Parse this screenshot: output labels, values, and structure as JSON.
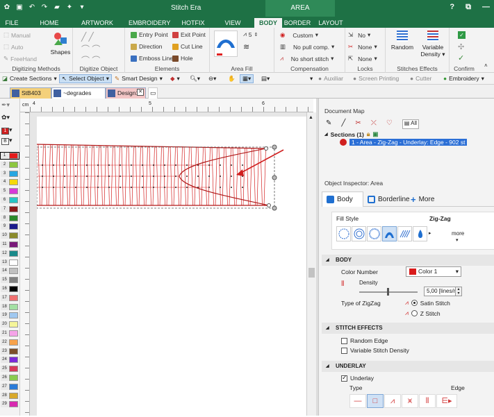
{
  "app": {
    "title": "Stitch Era",
    "context_tab": "AREA"
  },
  "window": {
    "help": "?",
    "restore": "⧉",
    "minimize": "—"
  },
  "tabs": [
    {
      "label": "FILE"
    },
    {
      "label": "HOME"
    },
    {
      "label": "ARTWORK"
    },
    {
      "label": "EMBROIDERY"
    },
    {
      "label": "HOTFIX"
    },
    {
      "label": "VIEW"
    },
    {
      "label": "BODY"
    },
    {
      "label": "BORDER"
    },
    {
      "label": "LAYOUT"
    }
  ],
  "ribbon": {
    "digitizing": {
      "manual": "Manual",
      "auto": "Auto",
      "freehand": "FreeHand",
      "shapes": "Shapes",
      "label": "Digitizing Methods"
    },
    "digitize_object": {
      "label": "Digitize Object"
    },
    "elements": {
      "entry": "Entry Point",
      "exit": "Exit Point",
      "direction": "Direction",
      "cutline": "Cut Line",
      "emboss": "Emboss Line",
      "hole": "Hole",
      "label": "Elements"
    },
    "area_fill": {
      "density_value": "5",
      "label": "Area Fill"
    },
    "compensation": {
      "custom": "Custom",
      "no_pull": "No pull comp.",
      "no_short": "No short stitch",
      "label": "Compensation"
    },
    "locks": {
      "no": "No",
      "none1": "None",
      "none2": "None",
      "label": "Locks"
    },
    "stitches_effects": {
      "random": "Random",
      "variable": "Variable",
      "density": "Density",
      "label": "Stitches Effects"
    },
    "confirm": {
      "label": "Confirm"
    }
  },
  "toolbar": {
    "create_sections": "Create Sections",
    "select_object": "Select Object",
    "smart_design": "Smart Design",
    "auxiliar": "Auxiliar",
    "screen_printing": "Screen Printing",
    "cutter": "Cutter",
    "embroidery": "Embroidery"
  },
  "doc_tabs": [
    {
      "label": "StB403",
      "color": "#f4d07a"
    },
    {
      "label": "~degrades",
      "color": "#ffffff"
    },
    {
      "label": "Design1",
      "color": "#f3c6c6"
    }
  ],
  "ruler": {
    "unit": "cm",
    "ticks": [
      "4",
      "5",
      "6"
    ]
  },
  "palette": [
    {
      "n": "1",
      "color": "#e31b1b"
    },
    {
      "n": "2",
      "color": "#8dc63f"
    },
    {
      "n": "3",
      "color": "#27a6e1"
    },
    {
      "n": "4",
      "color": "#f5d90a"
    },
    {
      "n": "5",
      "color": "#d83ad8"
    },
    {
      "n": "6",
      "color": "#26c6c6"
    },
    {
      "n": "7",
      "color": "#8b1a1a"
    },
    {
      "n": "8",
      "color": "#2b8a2b"
    },
    {
      "n": "9",
      "color": "#1a1a8b"
    },
    {
      "n": "10",
      "color": "#8a8a2b"
    },
    {
      "n": "11",
      "color": "#7a1a7a"
    },
    {
      "n": "12",
      "color": "#1a8a8a"
    },
    {
      "n": "13",
      "color": "#ffffff"
    },
    {
      "n": "14",
      "color": "#c0c0c0"
    },
    {
      "n": "15",
      "color": "#808080"
    },
    {
      "n": "16",
      "color": "#000000"
    },
    {
      "n": "17",
      "color": "#f07070"
    },
    {
      "n": "18",
      "color": "#a3e0a3"
    },
    {
      "n": "19",
      "color": "#a0c8f0"
    },
    {
      "n": "20",
      "color": "#f5f59a"
    },
    {
      "n": "21",
      "color": "#f5a3e8"
    },
    {
      "n": "22",
      "color": "#f7a24a"
    },
    {
      "n": "23",
      "color": "#7b4f2a"
    },
    {
      "n": "24",
      "color": "#7b2ad8"
    },
    {
      "n": "25",
      "color": "#d83a5a"
    },
    {
      "n": "26",
      "color": "#8acb4f"
    },
    {
      "n": "27",
      "color": "#2a7bd8"
    },
    {
      "n": "28",
      "color": "#d8a82a"
    },
    {
      "n": "29",
      "color": "#d82ab0"
    }
  ],
  "document_map": {
    "title": "Document Map",
    "all_label": "All",
    "sections": "Sections (1)",
    "item": "1 - Area - Zig-Zag - Underlay: Edge - 902 st"
  },
  "inspector": {
    "title": "Object Inspector: Area",
    "tabs": {
      "body": "Body",
      "borderline": "Borderline",
      "more": "More"
    },
    "fill_style_label": "Fill Style",
    "fill_style_value": "Zig-Zag",
    "more_label": "more",
    "body_header": "BODY",
    "color_number_label": "Color Number",
    "color_value": "Color 1",
    "color_hex": "#d91a1a",
    "density_label": "Density",
    "density_value": "5,00 [lines/mm]",
    "zigzag_type_label": "Type of ZigZag",
    "satin_label": "Satin Stitch",
    "z_label": "Z Stitch",
    "effects_header": "STITCH EFFECTS",
    "random_edge": "Random Edge",
    "variable_density": "Variable Stitch Density",
    "underlay_header": "UNDERLAY",
    "underlay_label": "Underlay",
    "type_label": "Type",
    "edge_label": "Edge"
  }
}
